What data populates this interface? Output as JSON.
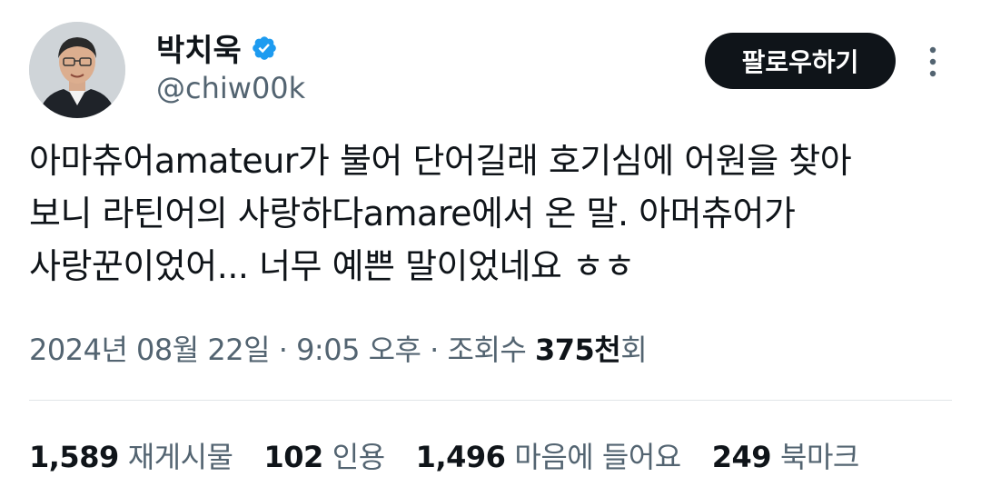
{
  "user": {
    "display_name": "박치욱",
    "handle": "@chiw00k",
    "verified": true,
    "verified_color": "#1d9bf0"
  },
  "actions": {
    "follow_label": "팔로우하기",
    "more_icon": "more-vertical-icon"
  },
  "tweet": {
    "text": "아마츄어amateur가 불어 단어길래 호기심에 어원을 찾아\n보니 라틴어의 사랑하다amare에서 온 말. 아머츄어가\n사랑꾼이었어... 너무 예쁜 말이었네요 ㅎㅎ",
    "date": "2024년 08월 22일",
    "sep1": " · ",
    "time": "9:05 오후",
    "sep2": " · ",
    "views_prefix": "조회수 ",
    "views_count": "375천",
    "views_suffix": "회"
  },
  "stats": [
    {
      "num": "1,589",
      "label": "재게시물"
    },
    {
      "num": "102",
      "label": "인용"
    },
    {
      "num": "1,496",
      "label": "마음에 들어요"
    },
    {
      "num": "249",
      "label": "북마크"
    }
  ],
  "colors": {
    "text": "#0f1419",
    "secondary": "#536471",
    "button_bg": "#0f1419"
  }
}
